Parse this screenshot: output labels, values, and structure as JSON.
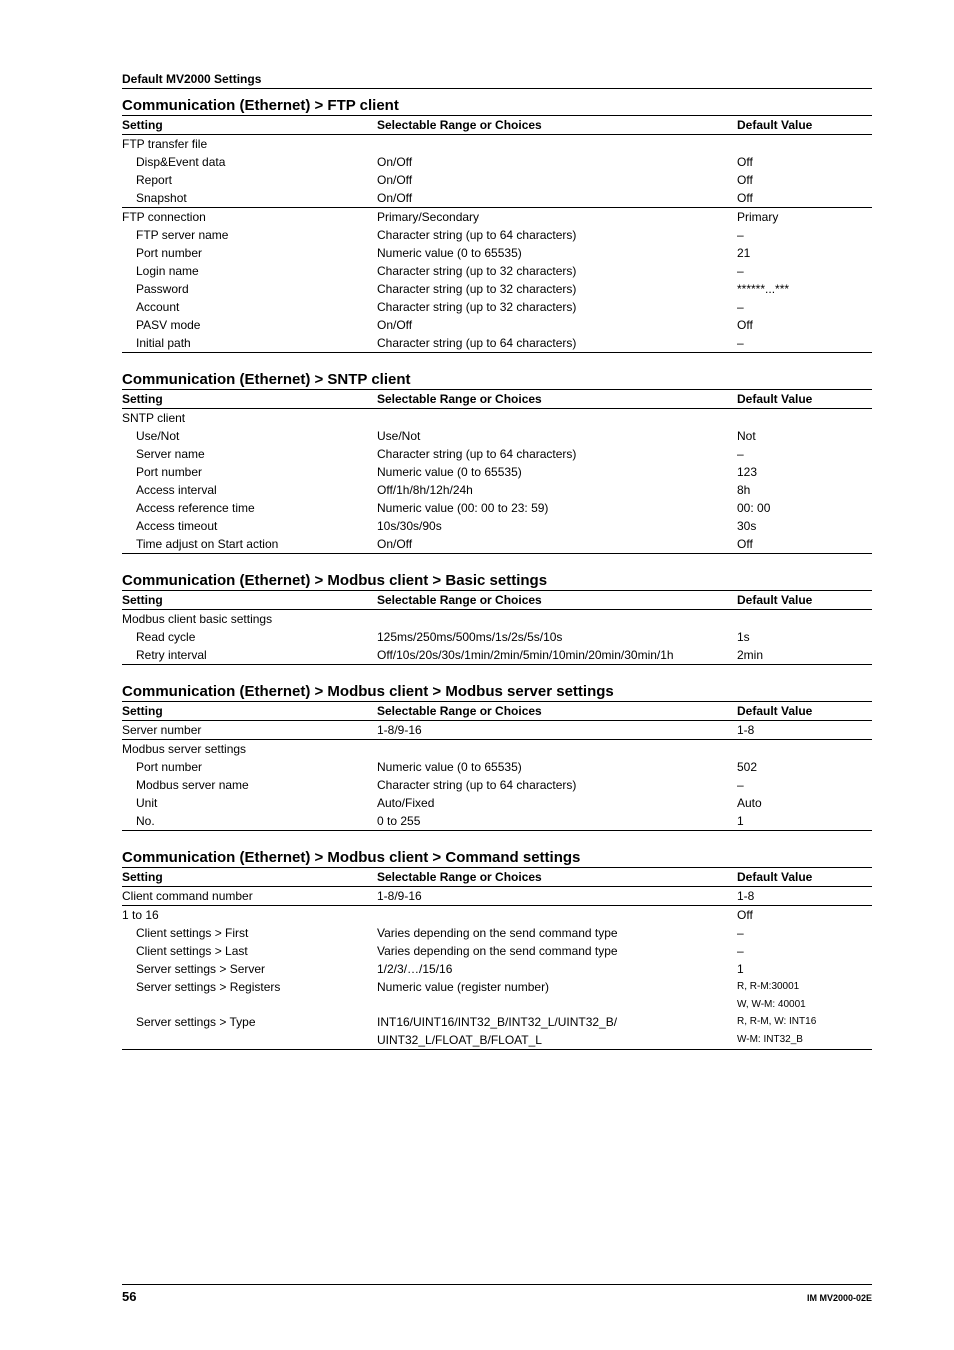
{
  "header": {
    "title": "Default MV2000 Settings"
  },
  "cols": {
    "setting": "Setting",
    "range": "Selectable Range or Choices",
    "default": "Default Value"
  },
  "sec1": {
    "title": "Communication (Ethernet) > FTP client",
    "r0": {
      "s": "FTP transfer file",
      "r": "",
      "d": ""
    },
    "r1": {
      "s": "Disp&Event data",
      "r": "On/Off",
      "d": "Off"
    },
    "r2": {
      "s": "Report",
      "r": "On/Off",
      "d": "Off"
    },
    "r3": {
      "s": "Snapshot",
      "r": "On/Off",
      "d": "Off"
    },
    "r4": {
      "s": "FTP connection",
      "r": "Primary/Secondary",
      "d": "Primary"
    },
    "r5": {
      "s": "FTP server name",
      "r": "Character string (up to 64 characters)",
      "d": "–"
    },
    "r6": {
      "s": "Port number",
      "r": "Numeric value (0 to 65535)",
      "d": "21"
    },
    "r7": {
      "s": "Login name",
      "r": "Character string (up to 32 characters)",
      "d": "–"
    },
    "r8": {
      "s": "Password",
      "r": "Character string (up to 32 characters)",
      "d": "******...***"
    },
    "r9": {
      "s": "Account",
      "r": "Character string (up to 32 characters)",
      "d": "–"
    },
    "r10": {
      "s": "PASV mode",
      "r": "On/Off",
      "d": "Off"
    },
    "r11": {
      "s": "Initial path",
      "r": "Character string (up to 64 characters)",
      "d": "–"
    }
  },
  "sec2": {
    "title": "Communication (Ethernet) > SNTP client",
    "r0": {
      "s": "SNTP client",
      "r": "",
      "d": ""
    },
    "r1": {
      "s": "Use/Not",
      "r": "Use/Not",
      "d": "Not"
    },
    "r2": {
      "s": "Server name",
      "r": "Character string (up to 64 characters)",
      "d": "–"
    },
    "r3": {
      "s": "Port number",
      "r": "Numeric value (0 to 65535)",
      "d": "123"
    },
    "r4": {
      "s": "Access interval",
      "r": "Off/1h/8h/12h/24h",
      "d": "8h"
    },
    "r5": {
      "s": "Access reference time",
      "r": "Numeric value (00: 00 to 23: 59)",
      "d": "00: 00"
    },
    "r6": {
      "s": "Access timeout",
      "r": "10s/30s/90s",
      "d": "30s"
    },
    "r7": {
      "s": "Time adjust on Start action",
      "r": "On/Off",
      "d": "Off"
    }
  },
  "sec3": {
    "title": "Communication (Ethernet) > Modbus client > Basic settings",
    "r0": {
      "s": "Modbus client basic settings",
      "r": "",
      "d": ""
    },
    "r1": {
      "s": "Read cycle",
      "r": "125ms/250ms/500ms/1s/2s/5s/10s",
      "d": "1s"
    },
    "r2": {
      "s": "Retry interval",
      "r": "Off/10s/20s/30s/1min/2min/5min/10min/20min/30min/1h",
      "d": "2min"
    }
  },
  "sec4": {
    "title": "Communication (Ethernet) > Modbus client > Modbus server settings",
    "r0": {
      "s": "Server number",
      "r": "1-8/9-16",
      "d": "1-8"
    },
    "r1": {
      "s": "Modbus server settings",
      "r": "",
      "d": ""
    },
    "r2": {
      "s": "Port number",
      "r": "Numeric value (0 to 65535)",
      "d": "502"
    },
    "r3": {
      "s": "Modbus server name",
      "r": "Character string (up to 64 characters)",
      "d": "–"
    },
    "r4": {
      "s": "Unit",
      "r": "Auto/Fixed",
      "d": "Auto"
    },
    "r5": {
      "s": "No.",
      "r": "0 to 255",
      "d": "1"
    }
  },
  "sec5": {
    "title": "Communication (Ethernet) > Modbus client > Command settings",
    "r0": {
      "s": "Client command number",
      "r": "1-8/9-16",
      "d": "1-8"
    },
    "r1": {
      "s": "1 to 16",
      "r": "",
      "d": "Off"
    },
    "r2": {
      "s": "Client settings > First",
      "r": "Varies depending on the send command type",
      "d": "–"
    },
    "r3": {
      "s": "Client settings > Last",
      "r": "Varies depending on the send command type",
      "d": "–"
    },
    "r4": {
      "s": "Server settings > Server",
      "r": "1/2/3/…/15/16",
      "d": "1"
    },
    "r5": {
      "s": "Server settings > Registers",
      "r": "Numeric value (register number)",
      "d": "R, R-M:30001"
    },
    "r5b": {
      "d": "W, W-M: 40001"
    },
    "r6": {
      "s": "Server settings > Type",
      "r": "INT16/UINT16/INT32_B/INT32_L/UINT32_B/",
      "d": "R, R-M, W: INT16"
    },
    "r6b": {
      "r": "UINT32_L/FLOAT_B/FLOAT_L",
      "d": "W-M: INT32_B"
    }
  },
  "footer": {
    "page": "56",
    "doc": "IM MV2000-02E"
  }
}
